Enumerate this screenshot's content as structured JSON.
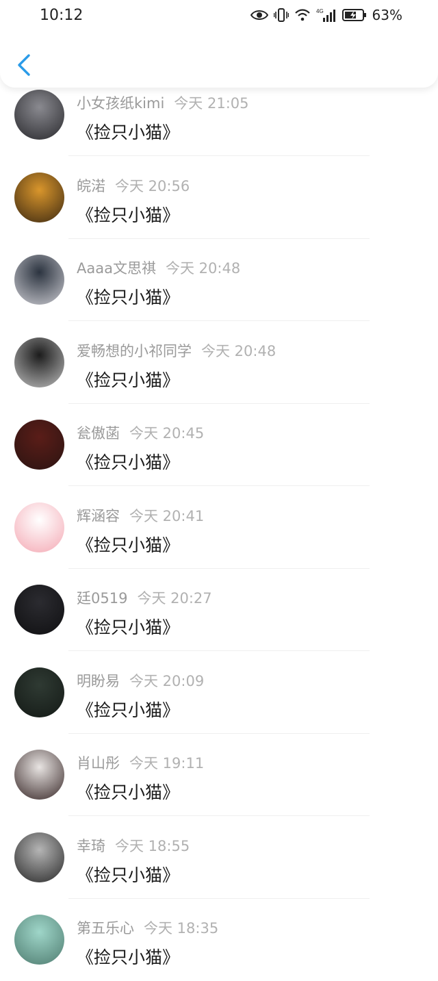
{
  "status_bar": {
    "time": "10:12",
    "network": "4G",
    "battery": "63%"
  },
  "items": [
    {
      "name": "小女孩纸kimi",
      "time": "今天 21:05",
      "message": "《捡只小猫》",
      "avatar_colors": [
        "#8a8a90",
        "#2a2a2e"
      ]
    },
    {
      "name": "皖渃",
      "time": "今天 20:56",
      "message": "《捡只小猫》",
      "avatar_colors": [
        "#d9962c",
        "#3e2a12"
      ]
    },
    {
      "name": "Aaaa文思祺",
      "time": "今天 20:48",
      "message": "《捡只小猫》",
      "avatar_colors": [
        "#2c3440",
        "#c9c9cf"
      ]
    },
    {
      "name": "爱畅想的小祁同学",
      "time": "今天 20:48",
      "message": "《捡只小猫》",
      "avatar_colors": [
        "#1c1c1c",
        "#bcbcbc"
      ]
    },
    {
      "name": "瓮傲菡",
      "time": "今天 20:45",
      "message": "《捡只小猫》",
      "avatar_colors": [
        "#5a1d18",
        "#2c1412"
      ]
    },
    {
      "name": "辉涵容",
      "time": "今天 20:41",
      "message": "《捡只小猫》",
      "avatar_colors": [
        "#ffffff",
        "#f4a9b4"
      ]
    },
    {
      "name": "廷0519",
      "time": "今天 20:27",
      "message": "《捡只小猫》",
      "avatar_colors": [
        "#2b2b30",
        "#101012"
      ]
    },
    {
      "name": "明盼易",
      "time": "今天 20:09",
      "message": "《捡只小猫》",
      "avatar_colors": [
        "#2f3a33",
        "#141a16"
      ]
    },
    {
      "name": "肖山彤",
      "time": "今天 19:11",
      "message": "《捡只小猫》",
      "avatar_colors": [
        "#e8e4e2",
        "#3a2a2a"
      ]
    },
    {
      "name": "幸琦",
      "time": "今天 18:55",
      "message": "《捡只小猫》",
      "avatar_colors": [
        "#b5b5b5",
        "#2a2a2a"
      ]
    },
    {
      "name": "第五乐心",
      "time": "今天 18:35",
      "message": "《捡只小猫》",
      "avatar_colors": [
        "#9fd6c9",
        "#4f7c70"
      ]
    }
  ]
}
